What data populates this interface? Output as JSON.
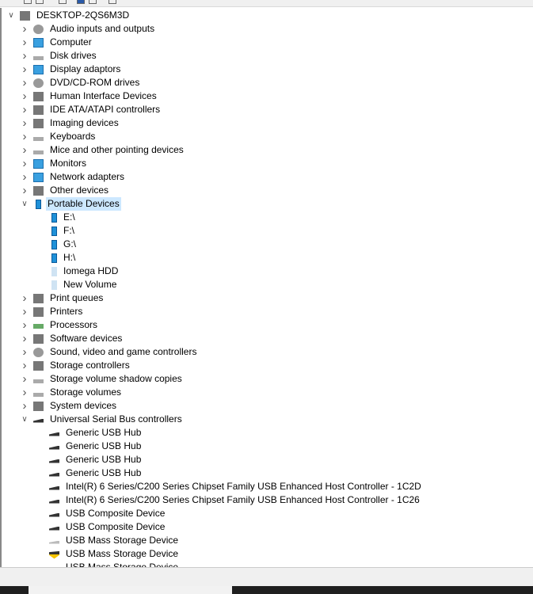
{
  "tree": [
    {
      "level": 0,
      "label": "DESKTOP-2QS6M3D",
      "icon": "computer-tower-icon",
      "expanded": true
    },
    {
      "level": 1,
      "label": "Audio inputs and outputs",
      "icon": "speaker-icon"
    },
    {
      "level": 1,
      "label": "Computer",
      "icon": "computer-icon"
    },
    {
      "level": 1,
      "label": "Disk drives",
      "icon": "disk-drive-icon"
    },
    {
      "level": 1,
      "label": "Display adaptors",
      "icon": "display-adapter-icon"
    },
    {
      "level": 1,
      "label": "DVD/CD-ROM drives",
      "icon": "dvd-drive-icon"
    },
    {
      "level": 1,
      "label": "Human Interface Devices",
      "icon": "hid-icon"
    },
    {
      "level": 1,
      "label": "IDE ATA/ATAPI controllers",
      "icon": "ide-controller-icon"
    },
    {
      "level": 1,
      "label": "Imaging devices",
      "icon": "camera-icon"
    },
    {
      "level": 1,
      "label": "Keyboards",
      "icon": "keyboard-icon"
    },
    {
      "level": 1,
      "label": "Mice and other pointing devices",
      "icon": "mouse-icon"
    },
    {
      "level": 1,
      "label": "Monitors",
      "icon": "monitor-icon"
    },
    {
      "level": 1,
      "label": "Network adapters",
      "icon": "network-adapter-icon"
    },
    {
      "level": 1,
      "label": "Other devices",
      "icon": "unknown-device-icon"
    },
    {
      "level": 1,
      "label": "Portable Devices",
      "icon": "portable-device-icon",
      "expanded": true,
      "selected": true
    },
    {
      "level": 2,
      "label": "E:\\",
      "icon": "portable-device-icon"
    },
    {
      "level": 2,
      "label": "F:\\",
      "icon": "portable-device-icon"
    },
    {
      "level": 2,
      "label": "G:\\",
      "icon": "portable-device-icon"
    },
    {
      "level": 2,
      "label": "H:\\",
      "icon": "portable-device-icon"
    },
    {
      "level": 2,
      "label": "Iomega HDD",
      "icon": "portable-device-faded-icon"
    },
    {
      "level": 2,
      "label": "New Volume",
      "icon": "portable-device-faded-icon"
    },
    {
      "level": 1,
      "label": "Print queues",
      "icon": "printer-icon"
    },
    {
      "level": 1,
      "label": "Printers",
      "icon": "printer-icon"
    },
    {
      "level": 1,
      "label": "Processors",
      "icon": "processor-icon"
    },
    {
      "level": 1,
      "label": "Software devices",
      "icon": "software-device-icon"
    },
    {
      "level": 1,
      "label": "Sound, video and game controllers",
      "icon": "speaker-icon"
    },
    {
      "level": 1,
      "label": "Storage controllers",
      "icon": "storage-controller-icon"
    },
    {
      "level": 1,
      "label": "Storage volume shadow copies",
      "icon": "disk-drive-icon"
    },
    {
      "level": 1,
      "label": "Storage volumes",
      "icon": "disk-drive-icon"
    },
    {
      "level": 1,
      "label": "System devices",
      "icon": "system-device-icon"
    },
    {
      "level": 1,
      "label": "Universal Serial Bus controllers",
      "icon": "usb-icon",
      "expanded": true
    },
    {
      "level": 2,
      "label": "Generic USB Hub",
      "icon": "usb-icon"
    },
    {
      "level": 2,
      "label": "Generic USB Hub",
      "icon": "usb-icon"
    },
    {
      "level": 2,
      "label": "Generic USB Hub",
      "icon": "usb-icon"
    },
    {
      "level": 2,
      "label": "Generic USB Hub",
      "icon": "usb-icon"
    },
    {
      "level": 2,
      "label": "Intel(R) 6 Series/C200 Series Chipset Family USB Enhanced Host Controller - 1C2D",
      "icon": "usb-icon"
    },
    {
      "level": 2,
      "label": "Intel(R) 6 Series/C200 Series Chipset Family USB Enhanced Host Controller - 1C26",
      "icon": "usb-icon"
    },
    {
      "level": 2,
      "label": "USB Composite Device",
      "icon": "usb-icon"
    },
    {
      "level": 2,
      "label": "USB Composite Device",
      "icon": "usb-icon"
    },
    {
      "level": 2,
      "label": "USB Mass Storage Device",
      "icon": "usb-faded-icon"
    },
    {
      "level": 2,
      "label": "USB Mass Storage Device",
      "icon": "usb-warning-icon"
    },
    {
      "level": 2,
      "label": "USB Mass Storage Device",
      "icon": "usb-icon"
    }
  ],
  "colors": {
    "selection": "#cce8ff",
    "accent": "#1e90d8"
  }
}
